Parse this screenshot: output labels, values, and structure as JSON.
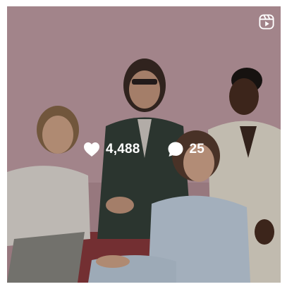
{
  "post": {
    "type_icon": "reel-icon",
    "likes": {
      "icon": "heart-icon",
      "count": "4,488"
    },
    "comments": {
      "icon": "comment-bubble-icon",
      "count": "25"
    }
  },
  "colors": {
    "backdrop": "#c9a5ab",
    "overlay_text": "#ffffff"
  }
}
